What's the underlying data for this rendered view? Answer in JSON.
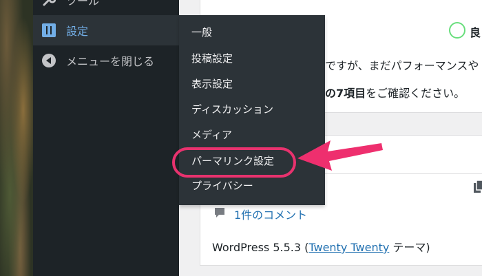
{
  "sidebar": {
    "tools_label": "ツール",
    "settings_label": "設定",
    "collapse_label": "メニューを閉じる"
  },
  "submenu": {
    "items": [
      {
        "label": "一般"
      },
      {
        "label": "投稿設定"
      },
      {
        "label": "表示設定"
      },
      {
        "label": "ディスカッション"
      },
      {
        "label": "メディア"
      },
      {
        "label": "パーマリンク設定"
      },
      {
        "label": "プライバシー"
      }
    ],
    "highlighted_index": 5
  },
  "site_health": {
    "status_label": "良",
    "line1": "ですが、まだパフォーマンスや",
    "line2_bold": "の7項目",
    "line2_rest": "をご確認ください。"
  },
  "activity": {
    "comment_link": "1件のコメント",
    "wp_prefix": "WordPress 5.5.3 (",
    "theme_link": "Twenty Twenty",
    "theme_suffix": " テーマ)"
  },
  "colors": {
    "sidebar_bg": "#1d2327",
    "submenu_bg": "#2c3338",
    "accent": "#72aee6",
    "highlight": "#e8326e",
    "link": "#2271b1",
    "status_good": "#68de7c"
  },
  "icons": {
    "tools": "wrench-icon",
    "settings": "settings-sliders-icon",
    "collapse": "collapse-arrow-icon",
    "comment": "comment-bubble-icon",
    "copy": "copy-icon"
  }
}
